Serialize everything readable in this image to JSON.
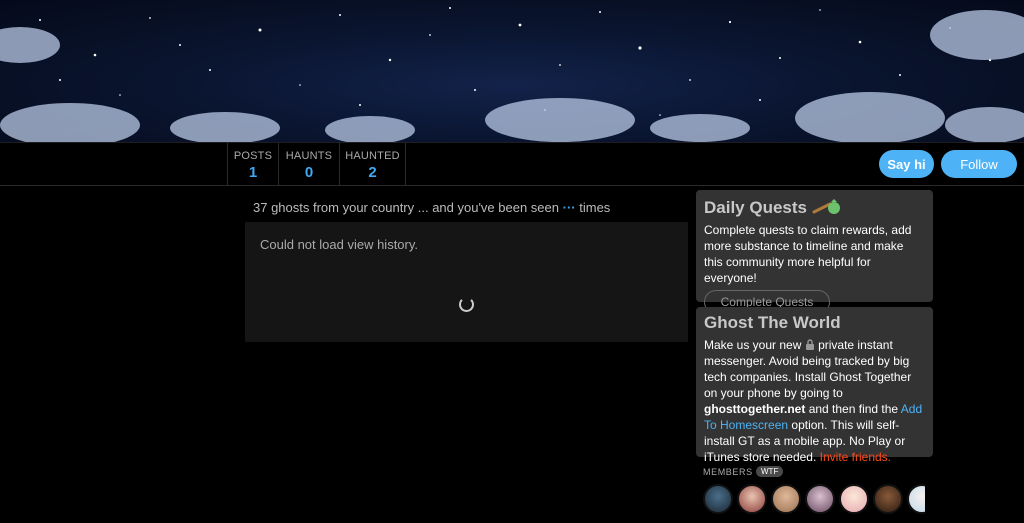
{
  "profile": {
    "stats": [
      {
        "label": "POSTS",
        "value": "1"
      },
      {
        "label": "HAUNTS",
        "value": "0"
      },
      {
        "label": "HAUNTED",
        "value": "2"
      }
    ],
    "say_hi_label": "Say hi",
    "follow_label": "Follow"
  },
  "main": {
    "seen_prefix": "37 ghosts from your country ... and you've been seen",
    "seen_dots": "···",
    "seen_suffix": "times",
    "history_message": "Could not load view history."
  },
  "sidebar": {
    "quests": {
      "title": "Daily Quests",
      "icon": "money-bag-icon",
      "text": "Complete quests to claim rewards, add more substance to timeline and make this community more helpful for everyone!",
      "button_label": "Complete Quests"
    },
    "ghost_world": {
      "title": "Ghost The World",
      "text_1": "Make us your new",
      "lock_icon": "lock-icon",
      "text_2": "private instant messenger. Avoid being tracked by big tech companies. Install Ghost Together on your phone by going to",
      "site": "ghosttogether.net",
      "text_3": "and then find the",
      "link_homescreen": "Add To Homescreen",
      "text_4": "option. This will self-install GT as a mobile app. No Play or iTunes store needed.",
      "link_invite": "Invite friends."
    },
    "members_label": "MEMBERS",
    "members_badge": "WTF"
  },
  "colors": {
    "accent": "#4db3f6",
    "invite": "#ff4a1a",
    "card_bg": "#333333"
  }
}
